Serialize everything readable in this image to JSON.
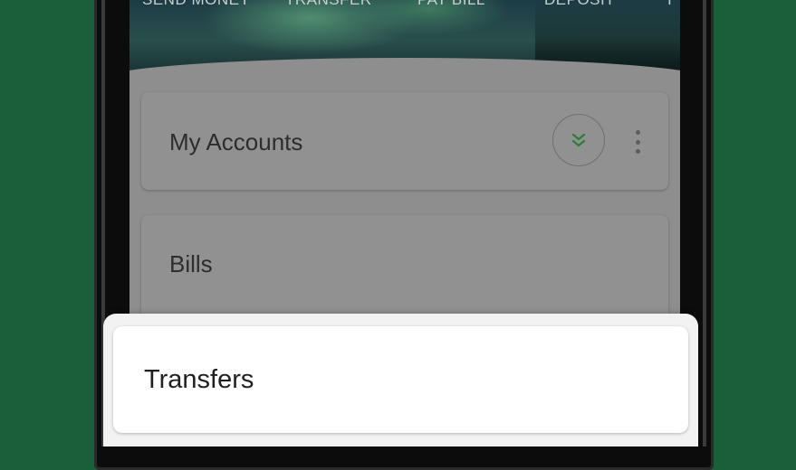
{
  "quick_actions": [
    {
      "label": "SEND MONEY"
    },
    {
      "label": "TRANSFER"
    },
    {
      "label": "PAY BILL"
    },
    {
      "label": "DEPOSIT"
    },
    {
      "label": "I"
    }
  ],
  "cards": {
    "accounts": {
      "title": "My Accounts",
      "expand_icon": "double-chevron-down-icon",
      "menu_icon": "kebab-menu-icon"
    },
    "bills": {
      "title": "Bills"
    }
  },
  "bottom_sheet": {
    "item_label": "Transfers"
  },
  "colors": {
    "page_background": "#1b5e3a",
    "accent_green": "#2e7d32",
    "sheet_background": "#f2f2f2"
  }
}
